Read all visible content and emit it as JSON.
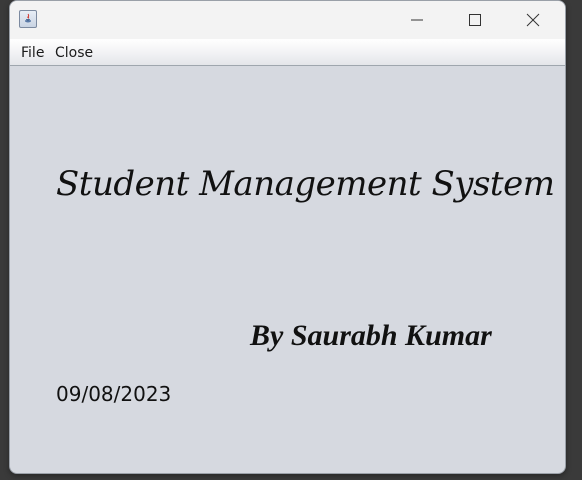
{
  "window": {
    "menu": [
      "File",
      "Close"
    ]
  },
  "content": {
    "title": "Student Management System",
    "author": "By Saurabh Kumar",
    "date": "09/08/2023"
  },
  "colors": {
    "window_bg": "#d6d9e0",
    "titlebar_bg": "#f3f3f3",
    "text": "#111111"
  },
  "icons": {
    "app": "java-app-icon",
    "minimize": "minimize-icon",
    "maximize": "maximize-icon",
    "close": "close-icon"
  }
}
